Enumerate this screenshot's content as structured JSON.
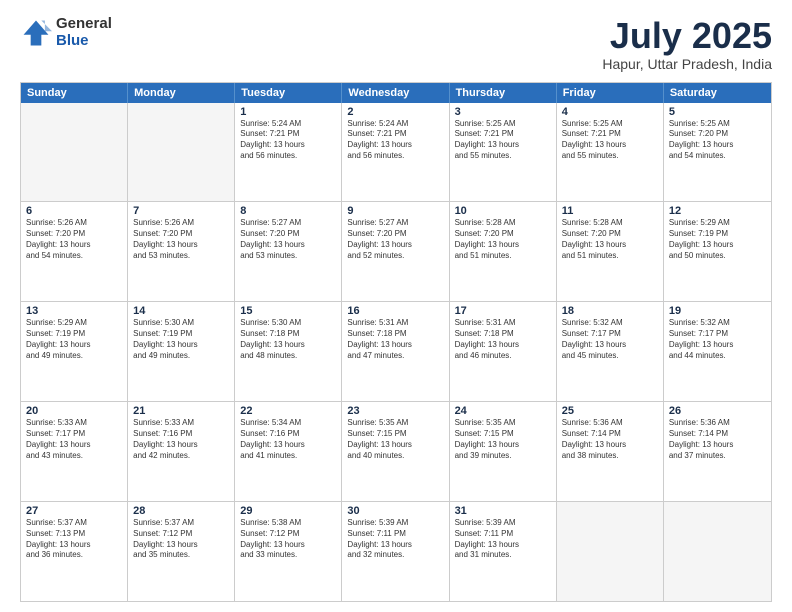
{
  "logo": {
    "general": "General",
    "blue": "Blue"
  },
  "title": "July 2025",
  "location": "Hapur, Uttar Pradesh, India",
  "days_of_week": [
    "Sunday",
    "Monday",
    "Tuesday",
    "Wednesday",
    "Thursday",
    "Friday",
    "Saturday"
  ],
  "weeks": [
    [
      {
        "day": "",
        "info": "",
        "empty": true
      },
      {
        "day": "",
        "info": "",
        "empty": true
      },
      {
        "day": "1",
        "info": "Sunrise: 5:24 AM\nSunset: 7:21 PM\nDaylight: 13 hours\nand 56 minutes."
      },
      {
        "day": "2",
        "info": "Sunrise: 5:24 AM\nSunset: 7:21 PM\nDaylight: 13 hours\nand 56 minutes."
      },
      {
        "day": "3",
        "info": "Sunrise: 5:25 AM\nSunset: 7:21 PM\nDaylight: 13 hours\nand 55 minutes."
      },
      {
        "day": "4",
        "info": "Sunrise: 5:25 AM\nSunset: 7:21 PM\nDaylight: 13 hours\nand 55 minutes."
      },
      {
        "day": "5",
        "info": "Sunrise: 5:25 AM\nSunset: 7:20 PM\nDaylight: 13 hours\nand 54 minutes."
      }
    ],
    [
      {
        "day": "6",
        "info": "Sunrise: 5:26 AM\nSunset: 7:20 PM\nDaylight: 13 hours\nand 54 minutes."
      },
      {
        "day": "7",
        "info": "Sunrise: 5:26 AM\nSunset: 7:20 PM\nDaylight: 13 hours\nand 53 minutes."
      },
      {
        "day": "8",
        "info": "Sunrise: 5:27 AM\nSunset: 7:20 PM\nDaylight: 13 hours\nand 53 minutes."
      },
      {
        "day": "9",
        "info": "Sunrise: 5:27 AM\nSunset: 7:20 PM\nDaylight: 13 hours\nand 52 minutes."
      },
      {
        "day": "10",
        "info": "Sunrise: 5:28 AM\nSunset: 7:20 PM\nDaylight: 13 hours\nand 51 minutes."
      },
      {
        "day": "11",
        "info": "Sunrise: 5:28 AM\nSunset: 7:20 PM\nDaylight: 13 hours\nand 51 minutes."
      },
      {
        "day": "12",
        "info": "Sunrise: 5:29 AM\nSunset: 7:19 PM\nDaylight: 13 hours\nand 50 minutes."
      }
    ],
    [
      {
        "day": "13",
        "info": "Sunrise: 5:29 AM\nSunset: 7:19 PM\nDaylight: 13 hours\nand 49 minutes."
      },
      {
        "day": "14",
        "info": "Sunrise: 5:30 AM\nSunset: 7:19 PM\nDaylight: 13 hours\nand 49 minutes."
      },
      {
        "day": "15",
        "info": "Sunrise: 5:30 AM\nSunset: 7:18 PM\nDaylight: 13 hours\nand 48 minutes."
      },
      {
        "day": "16",
        "info": "Sunrise: 5:31 AM\nSunset: 7:18 PM\nDaylight: 13 hours\nand 47 minutes."
      },
      {
        "day": "17",
        "info": "Sunrise: 5:31 AM\nSunset: 7:18 PM\nDaylight: 13 hours\nand 46 minutes."
      },
      {
        "day": "18",
        "info": "Sunrise: 5:32 AM\nSunset: 7:17 PM\nDaylight: 13 hours\nand 45 minutes."
      },
      {
        "day": "19",
        "info": "Sunrise: 5:32 AM\nSunset: 7:17 PM\nDaylight: 13 hours\nand 44 minutes."
      }
    ],
    [
      {
        "day": "20",
        "info": "Sunrise: 5:33 AM\nSunset: 7:17 PM\nDaylight: 13 hours\nand 43 minutes."
      },
      {
        "day": "21",
        "info": "Sunrise: 5:33 AM\nSunset: 7:16 PM\nDaylight: 13 hours\nand 42 minutes."
      },
      {
        "day": "22",
        "info": "Sunrise: 5:34 AM\nSunset: 7:16 PM\nDaylight: 13 hours\nand 41 minutes."
      },
      {
        "day": "23",
        "info": "Sunrise: 5:35 AM\nSunset: 7:15 PM\nDaylight: 13 hours\nand 40 minutes."
      },
      {
        "day": "24",
        "info": "Sunrise: 5:35 AM\nSunset: 7:15 PM\nDaylight: 13 hours\nand 39 minutes."
      },
      {
        "day": "25",
        "info": "Sunrise: 5:36 AM\nSunset: 7:14 PM\nDaylight: 13 hours\nand 38 minutes."
      },
      {
        "day": "26",
        "info": "Sunrise: 5:36 AM\nSunset: 7:14 PM\nDaylight: 13 hours\nand 37 minutes."
      }
    ],
    [
      {
        "day": "27",
        "info": "Sunrise: 5:37 AM\nSunset: 7:13 PM\nDaylight: 13 hours\nand 36 minutes."
      },
      {
        "day": "28",
        "info": "Sunrise: 5:37 AM\nSunset: 7:12 PM\nDaylight: 13 hours\nand 35 minutes."
      },
      {
        "day": "29",
        "info": "Sunrise: 5:38 AM\nSunset: 7:12 PM\nDaylight: 13 hours\nand 33 minutes."
      },
      {
        "day": "30",
        "info": "Sunrise: 5:39 AM\nSunset: 7:11 PM\nDaylight: 13 hours\nand 32 minutes."
      },
      {
        "day": "31",
        "info": "Sunrise: 5:39 AM\nSunset: 7:11 PM\nDaylight: 13 hours\nand 31 minutes."
      },
      {
        "day": "",
        "info": "",
        "empty": true
      },
      {
        "day": "",
        "info": "",
        "empty": true
      }
    ]
  ]
}
